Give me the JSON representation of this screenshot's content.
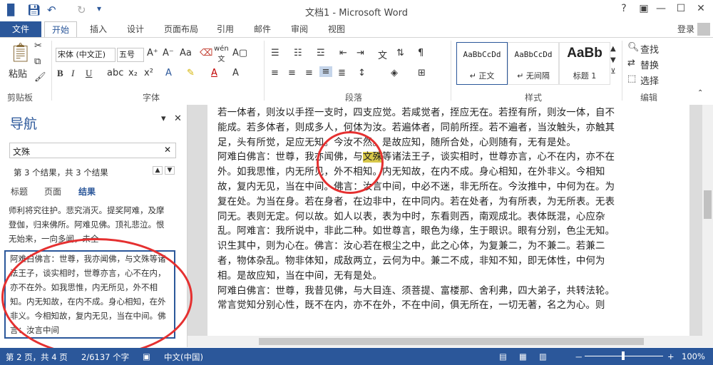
{
  "window": {
    "title": "文档1 - Microsoft Word"
  },
  "quick_access": {
    "save_icon": "save-icon",
    "undo_icon": "undo-icon",
    "redo_icon": "redo-icon"
  },
  "window_controls": {
    "help": "?",
    "restore_ribbon": "▣",
    "minimize": "—",
    "maximize": "☐",
    "close": "✕"
  },
  "ribbon": {
    "tabs": [
      "文件",
      "开始",
      "插入",
      "设计",
      "页面布局",
      "引用",
      "邮件",
      "审阅",
      "视图"
    ],
    "login": "登录",
    "clipboard": {
      "paste": "粘贴",
      "label": "剪贴板"
    },
    "font": {
      "name": "宋体 (中文正)",
      "size": "五号",
      "label": "字体",
      "bold": "B",
      "italic": "I",
      "underline": "U"
    },
    "paragraph": {
      "label": "段落"
    },
    "styles": {
      "label": "样式",
      "items": [
        {
          "sample": "AaBbCcDd",
          "name": "↵ 正文"
        },
        {
          "sample": "AaBbCcDd",
          "name": "↵ 无间隔"
        },
        {
          "sample": "AaBb",
          "name": "标题 1"
        }
      ]
    },
    "editing": {
      "find": "查找",
      "replace": "替换",
      "select": "选择",
      "label": "编辑"
    }
  },
  "nav_pane": {
    "title": "导航",
    "search_value": "文殊",
    "result_count": "第 3 个结果，共 3 个结果",
    "tabs": [
      "标题",
      "页面",
      "结果"
    ],
    "results": [
      "师利将究往护。悲究消灭。提奖阿难，及摩登伽，归来佛所。阿难见佛。顶礼悲泣。恨无始来，一向多闻，未全",
      "阿难白佛言：世尊，我亦闻佛，与文殊等诸法王子，谈实相时，世尊亦言，心不在内，亦不在外。如我思惟，内无所见，外不相知。内无知故，在内不成。身心相知，在外非义。今相知故，复内无见，当在中间。佛言：汝言中间"
    ]
  },
  "document": {
    "paragraphs": [
      "若一体者，则汝以手挃一支时，四支应觉。若咸觉者，挃应无在。若挃有所，则汝一体，自不能成。若多体者，则成多人，何体为汝。若遍体者，同前所挃。若不遍者，当汝触头，亦触其足，头有所觉，足应无知。今汝不然。是故应知，随所合处，心则随有，无有是处。",
      "阿难白佛言：世尊，我亦闻佛，与",
      "文殊",
      "等诸法王子，谈实相时，世尊亦言，心不在内，亦不在外。如我思惟，内无所见，外不相知。内无知故，在内不成。身心相知，在外非义。今相知故，复内无见，当在中间。佛言：汝言中间，中必不迷，非无所在。今汝推中，中何为在。为复在处。为当在身。若在身者，在边非中，在中同内。若在处者，为有所表，为无所表。无表同无。表则无定。何以故。如人以表，表为中时，东看则西，南观成北。表体既混，心应杂乱。阿难言：我所说中，非此二种。如世尊言，眼色为缘，生于眼识。眼有分别，色尘无知。识生其中，则为心在。佛言：汝心若在根尘之中，此之心体，为复兼二，为不兼二。若兼二者，物体杂乱。物非体知，成敌两立，云何为中。兼二不成，非知不知，即无体性，中何为相。是故应知，当在中间，无有是处。",
      "阿难白佛言：世尊，我昔见佛，与大目连、须菩提、富楼那、舍利弗，四大弟子，共转法轮。常言觉知分别心性，既不在内，亦不在外，不在中间，俱无所在，一切无著，名之为心。则"
    ]
  },
  "status_bar": {
    "page": "第 2 页，共 4 页",
    "words": "2/6137 个字",
    "language": "中文(中国)",
    "zoom_minus": "－",
    "zoom_plus": "+",
    "zoom": "100%"
  }
}
